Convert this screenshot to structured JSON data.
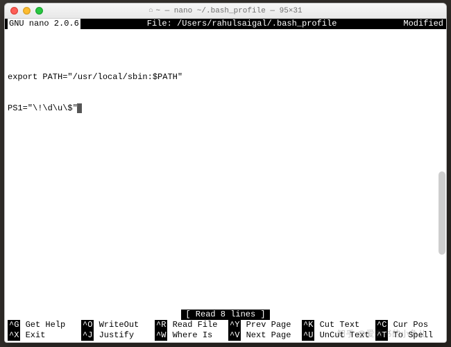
{
  "window": {
    "title": "~ — nano ~/.bash_profile — 95×31"
  },
  "nano": {
    "title": "GNU nano 2.0.6",
    "file_label": "File: /Users/rahulsaigal/.bash_profile",
    "modified": "Modified"
  },
  "content": {
    "lines": [
      "",
      "export PATH=\"/usr/local/sbin:$PATH\"",
      "PS1=\"\\!\\d\\u\\$\""
    ]
  },
  "status": "[ Read 8 lines ]",
  "shortcuts": {
    "row1": [
      {
        "key": "^G",
        "label": "Get Help"
      },
      {
        "key": "^O",
        "label": "WriteOut"
      },
      {
        "key": "^R",
        "label": "Read File"
      },
      {
        "key": "^Y",
        "label": "Prev Page"
      },
      {
        "key": "^K",
        "label": "Cut Text"
      },
      {
        "key": "^C",
        "label": "Cur Pos"
      }
    ],
    "row2": [
      {
        "key": "^X",
        "label": "Exit"
      },
      {
        "key": "^J",
        "label": "Justify"
      },
      {
        "key": "^W",
        "label": "Where Is"
      },
      {
        "key": "^V",
        "label": "Next Page"
      },
      {
        "key": "^U",
        "label": "UnCut Text"
      },
      {
        "key": "^T",
        "label": "To Spell"
      }
    ]
  },
  "watermark": "知乎 @爱看书的小鱼儿"
}
